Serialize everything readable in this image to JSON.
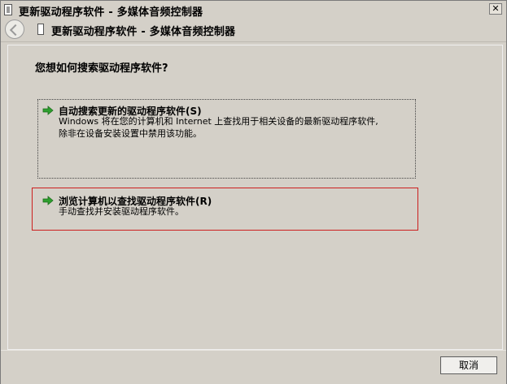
{
  "window": {
    "title": "更新驱动程序软件 - 多媒体音频控制器",
    "close_glyph": "✕"
  },
  "navbar": {
    "title": "更新驱动程序软件 - 多媒体音频控制器"
  },
  "main": {
    "question": "您想如何搜索驱动程序软件?",
    "options": [
      {
        "title": "自动搜索更新的驱动程序软件(S)",
        "desc_line1": "Windows 将在您的计算机和 Internet 上查找用于相关设备的最新驱动程序软件,",
        "desc_line2": "除非在设备安装设置中禁用该功能。",
        "icon": "green-arrow-icon"
      },
      {
        "title": "浏览计算机以查找驱动程序软件(R)",
        "desc_line1": "手动查找并安装驱动程序软件。",
        "icon": "green-arrow-icon"
      }
    ]
  },
  "footer": {
    "cancel_label": "取消"
  },
  "colors": {
    "background": "#d4d0c8",
    "selected_border": "#cc1f1f",
    "arrow_green": "#2e9f2e"
  }
}
